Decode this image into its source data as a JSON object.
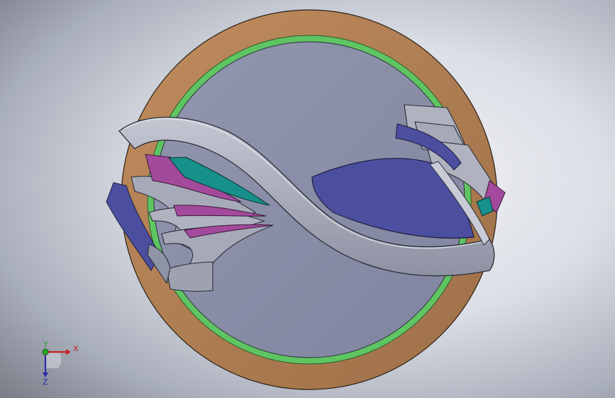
{
  "viewport": {
    "background": "#dcdfe6"
  },
  "model": {
    "parts": [
      {
        "name": "outer-disc",
        "color": "#b58358"
      },
      {
        "name": "green-ring",
        "color": "#5ec562"
      },
      {
        "name": "inner-disc",
        "color": "#8b90a9"
      },
      {
        "name": "twisted-blades",
        "color": "#a6aab8"
      },
      {
        "name": "blue-face",
        "color": "#4c4f9f"
      },
      {
        "name": "magenta-face",
        "color": "#a34a9c"
      },
      {
        "name": "teal-face",
        "color": "#178f8a"
      }
    ]
  },
  "triad": {
    "x_label": "X",
    "y_label": "Y",
    "z_label": "Z",
    "x_color": "#c62020",
    "y_color": "#2aa02a",
    "z_color": "#2a2aa8"
  }
}
